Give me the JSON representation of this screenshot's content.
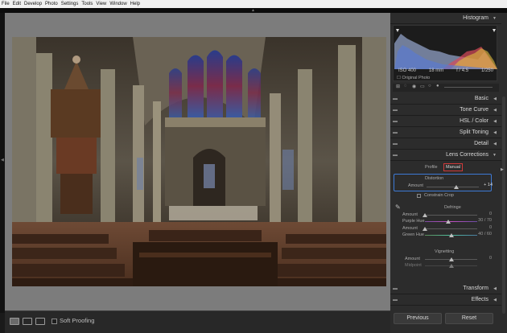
{
  "menu": [
    "File",
    "Edit",
    "Develop",
    "Photo",
    "Settings",
    "Tools",
    "View",
    "Window",
    "Help"
  ],
  "histogram": {
    "title": "Histogram",
    "iso": "ISO 400",
    "focal": "18 mm",
    "aperture": "f / 4.5",
    "shutter": "1/250",
    "original_label": "Original Photo"
  },
  "panels": {
    "basic": "Basic",
    "tone_curve": "Tone Curve",
    "hsl": "HSL / Color",
    "split_toning": "Split Toning",
    "detail": "Detail",
    "lens_corrections": "Lens Corrections",
    "transform": "Transform",
    "effects": "Effects"
  },
  "lens": {
    "profile_label": "Profile",
    "manual_label": "Manual",
    "distortion_title": "Distortion",
    "amount_label": "Amount",
    "amount_value": "+ 14",
    "amount_level": 0.57,
    "constrain_crop": "Constrain Crop",
    "defringe_title": "Defringe",
    "defringe": [
      {
        "label": "Amount",
        "value": "0",
        "level": 0.0
      },
      {
        "label": "Purple Hue",
        "value": "30 / 70",
        "level": 0.45
      },
      {
        "label": "Amount",
        "value": "0",
        "level": 0.0
      },
      {
        "label": "Green Hue",
        "value": "40 / 60",
        "level": 0.5
      }
    ],
    "vignetting_title": "Vignetting",
    "vignetting": [
      {
        "label": "Amount",
        "value": "0",
        "level": 0.5
      },
      {
        "label": "Midpoint",
        "value": "",
        "level": 0.5
      }
    ]
  },
  "buttons": {
    "previous": "Previous",
    "reset": "Reset"
  },
  "toolbar": {
    "soft_proofing": "Soft Proofing"
  },
  "colors": {
    "accent_blue": "#3d7ad6",
    "manual_red": "#d03a3a"
  }
}
